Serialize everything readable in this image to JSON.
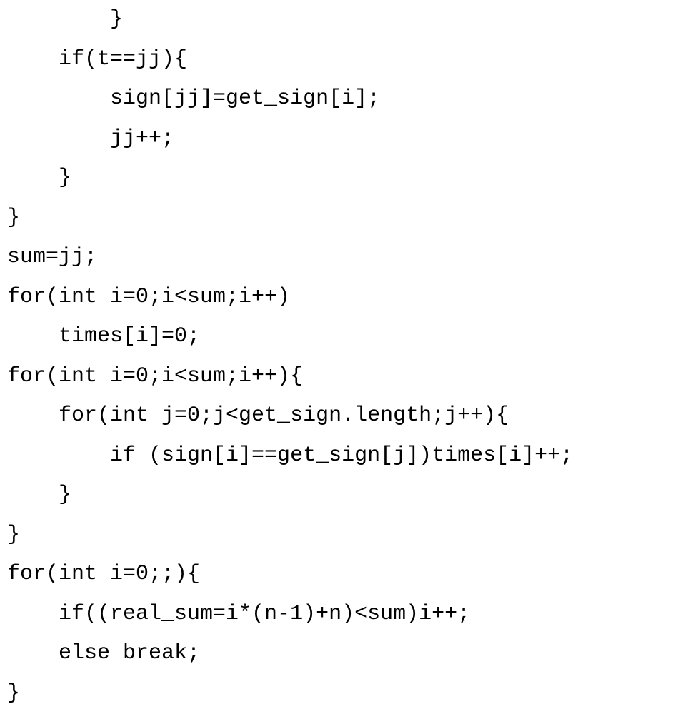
{
  "code": {
    "lines": [
      "        }",
      "    if(t==jj){",
      "        sign[jj]=get_sign[i];",
      "        jj++;",
      "    }",
      "}",
      "sum=jj;",
      "for(int i=0;i<sum;i++)",
      "    times[i]=0;",
      "for(int i=0;i<sum;i++){",
      "    for(int j=0;j<get_sign.length;j++){",
      "        if (sign[i]==get_sign[j])times[i]++;",
      "    }",
      "}",
      "for(int i=0;;){",
      "    if((real_sum=i*(n-1)+n)<sum)i++;",
      "    else break;",
      "}"
    ]
  }
}
